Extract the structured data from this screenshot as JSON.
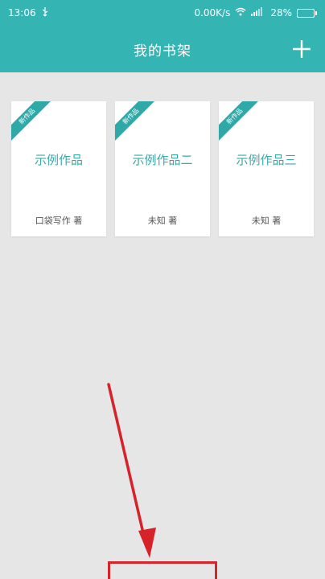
{
  "status_bar": {
    "time": "13:06",
    "usb_icon": "usb-icon",
    "network_speed": "0.00K/s",
    "wifi_icon": "wifi-icon",
    "signal_icon": "signal-icon",
    "battery_percent": "28%",
    "battery_level": 0.28
  },
  "appbar": {
    "title": "我的书架",
    "add_icon": "plus-icon",
    "color": "#34b5b3"
  },
  "books": [
    {
      "ribbon": "新作品",
      "title": "示例作品",
      "author": "口袋写作 著"
    },
    {
      "ribbon": "新作品",
      "title": "示例作品二",
      "author": "未知 著"
    },
    {
      "ribbon": "新作品",
      "title": "示例作品三",
      "author": "未知 著"
    }
  ],
  "annotation": {
    "color": "#d6232a"
  }
}
